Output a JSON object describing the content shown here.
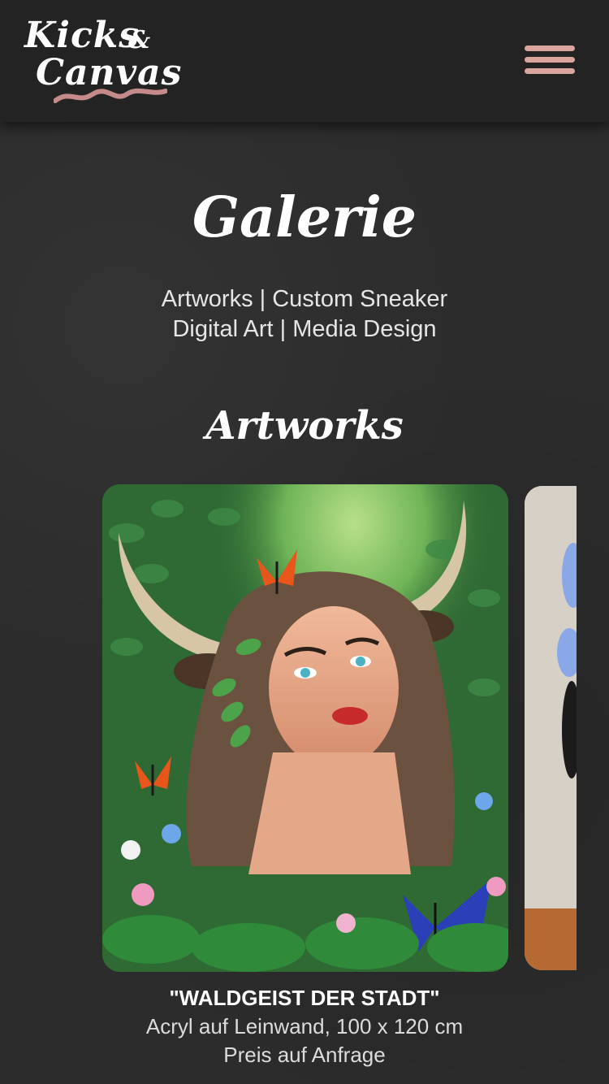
{
  "header": {
    "logo_line1": "Kicks",
    "logo_amp": "&",
    "logo_line2": "Canvas",
    "menu_icon": "hamburger-menu-icon",
    "menu_color": "#d9a59d"
  },
  "page": {
    "title": "Galerie",
    "subtitle_line1": "Artworks | Custom Sneaker",
    "subtitle_line2": "Digital Art | Media Design"
  },
  "section": {
    "title": "Artworks"
  },
  "artworks": [
    {
      "title": "\"WALDGEIST DER STADT\"",
      "medium": "Acryl auf Leinwand, 100 x 120 cm",
      "price": "Preis auf Anfrage"
    }
  ]
}
